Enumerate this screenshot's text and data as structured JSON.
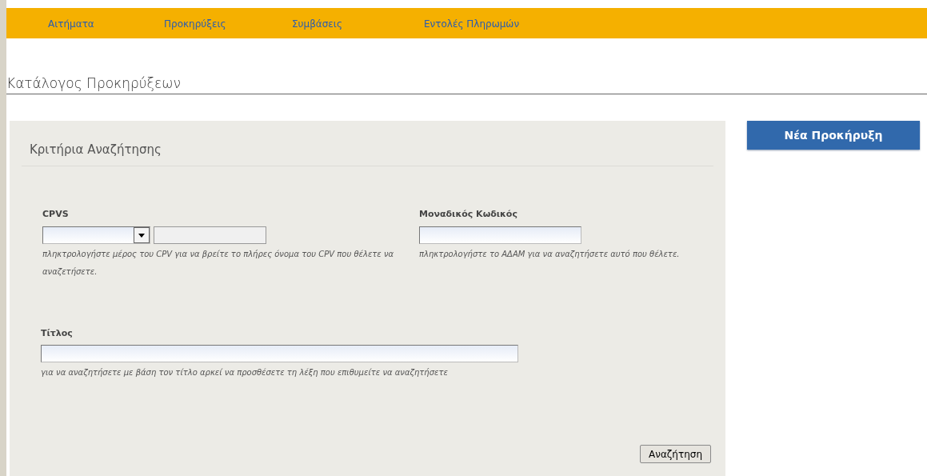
{
  "nav": [
    "Αιτήματα",
    "Προκηρύξεις",
    "Συμβάσεις",
    "Εντολές Πληρωμών"
  ],
  "page_title": "Κατάλογος Προκηρύξεων",
  "search_panel": {
    "heading": "Κριτήρια Αναζήτησης",
    "fields": [
      {
        "kind": "cpv",
        "label": "CPVS",
        "hint": "πληκτρολογήστε μέρος του CPV για να βρείτε το πλήρες όνομα του CPV που θέλετε να αναζετήσετε."
      },
      {
        "kind": "text",
        "label": "Μοναδικός Κωδικός",
        "hint": "πληκτρολογήστε το ΑΔΑΜ για να αναζητήσετε αυτό που θέλετε."
      },
      {
        "kind": "wide",
        "label": "Τίτλος",
        "hint": "για να αναζητήσετε με βάση τον τίτλο αρκεί να προσθέσετε τη λέξη που επιθυμείτε να αναζητήσετε"
      }
    ],
    "search_button": "Αναζήτηση"
  },
  "new_button": "Νέα Προκήρυξη"
}
